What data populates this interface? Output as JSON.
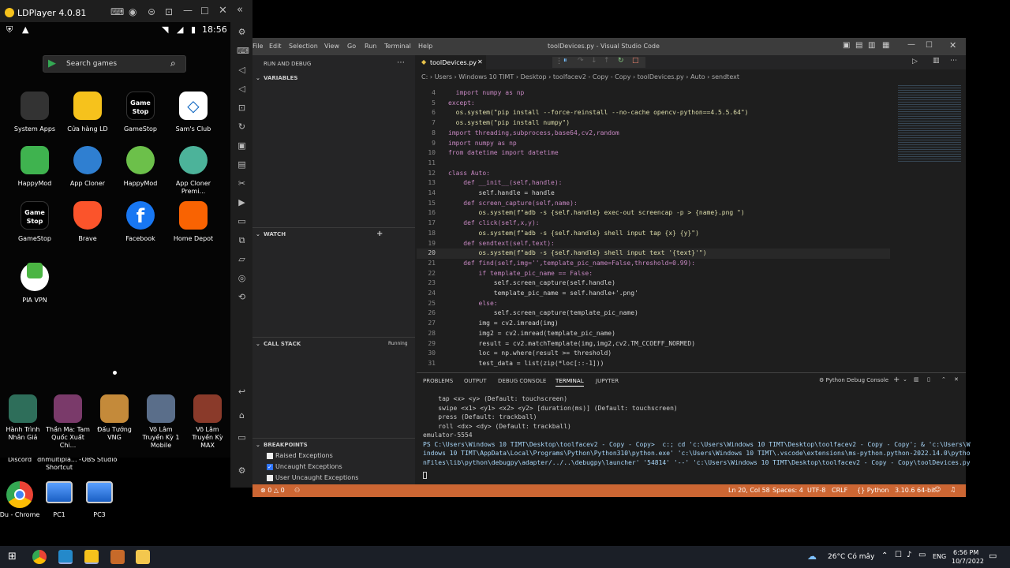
{
  "desktop": {
    "icons": [
      {
        "label": "Discord",
        "name": "discord"
      },
      {
        "label": "dnmultipla... - Shortcut",
        "name": "dnmultiplayer-shortcut"
      },
      {
        "label": "OBS Studio",
        "name": "obs-studio"
      },
      {
        "label": "Du - Chrome",
        "name": "chrome-shortcut"
      },
      {
        "label": "PC1",
        "name": "pc1"
      },
      {
        "label": "PC3",
        "name": "pc3"
      }
    ]
  },
  "ldplayer": {
    "title": "LDPlayer 4.0.81",
    "time": "18:56",
    "search_placeholder": "Search games",
    "apps": [
      {
        "label": "System Apps"
      },
      {
        "label": "Cửa hàng LD"
      },
      {
        "label": "GameStop"
      },
      {
        "label": "Sam's Club"
      },
      {
        "label": "HappyMod"
      },
      {
        "label": "App Cloner"
      },
      {
        "label": "HappyMod"
      },
      {
        "label": "App Cloner Premi..."
      },
      {
        "label": "GameStop"
      },
      {
        "label": "Brave"
      },
      {
        "label": "Facebook"
      },
      {
        "label": "Home Depot"
      },
      {
        "label": "PIA VPN"
      }
    ],
    "games": [
      {
        "label": "Hành Trình Nhân Giả"
      },
      {
        "label": "Thần Ma: Tam Quốc Xuất Chi..."
      },
      {
        "label": "Đấu Tướng VNG"
      },
      {
        "label": "Võ Lâm Truyền Kỳ 1 Mobile"
      },
      {
        "label": "Võ Lâm Truyền Kỳ MAX"
      }
    ]
  },
  "vscode": {
    "window_title": "toolDevices.py - Visual Studio Code",
    "menu": [
      "File",
      "Edit",
      "Selection",
      "View",
      "Go",
      "Run",
      "Terminal",
      "Help"
    ],
    "sidebar": {
      "header": "RUN AND DEBUG",
      "variables": "VARIABLES",
      "watch": "WATCH",
      "call_stack": "CALL STACK",
      "call_stack_status": "Running",
      "breakpoints": "BREAKPOINTS",
      "breakpoint_items": [
        {
          "label": "Raised Exceptions",
          "checked": false
        },
        {
          "label": "Uncaught Exceptions",
          "checked": true
        },
        {
          "label": "User Uncaught Exceptions",
          "checked": false
        }
      ]
    },
    "tab": "toolDevices.py",
    "breadcrumb": [
      "C:",
      "Users",
      "Windows 10 TIMT",
      "Desktop",
      "toolfacev2 - Copy - Copy",
      "toolDevices.py",
      "Auto",
      "sendtext"
    ],
    "code": [
      {
        "n": "4",
        "t": "  import numpy as np"
      },
      {
        "n": "5",
        "t": "except:"
      },
      {
        "n": "6",
        "t": "  os.system(\"pip install --force-reinstall --no-cache opencv-python==4.5.5.64\")"
      },
      {
        "n": "7",
        "t": "  os.system(\"pip install numpy\")"
      },
      {
        "n": "8",
        "t": "import threading,subprocess,base64,cv2,random"
      },
      {
        "n": "9",
        "t": "import numpy as np"
      },
      {
        "n": "10",
        "t": "from datetime import datetime"
      },
      {
        "n": "11",
        "t": ""
      },
      {
        "n": "12",
        "t": "class Auto:"
      },
      {
        "n": "13",
        "t": "    def __init__(self,handle):"
      },
      {
        "n": "14",
        "t": "        self.handle = handle"
      },
      {
        "n": "15",
        "t": "    def screen_capture(self,name):"
      },
      {
        "n": "16",
        "t": "        os.system(f\"adb -s {self.handle} exec-out screencap -p > {name}.png \")"
      },
      {
        "n": "17",
        "t": "    def click(self,x,y):"
      },
      {
        "n": "18",
        "t": "        os.system(f\"adb -s {self.handle} shell input tap {x} {y}\")"
      },
      {
        "n": "19",
        "t": "    def sendtext(self,text):"
      },
      {
        "n": "20",
        "t": "        os.system(f\"adb -s {self.handle} shell input text '{text}'\")"
      },
      {
        "n": "21",
        "t": "    def find(self,img='',template_pic_name=False,threshold=0.99):"
      },
      {
        "n": "22",
        "t": "        if template_pic_name == False:"
      },
      {
        "n": "23",
        "t": "            self.screen_capture(self.handle)"
      },
      {
        "n": "24",
        "t": "            template_pic_name = self.handle+'.png'"
      },
      {
        "n": "25",
        "t": "        else:"
      },
      {
        "n": "26",
        "t": "            self.screen_capture(template_pic_name)"
      },
      {
        "n": "27",
        "t": "        img = cv2.imread(img)"
      },
      {
        "n": "28",
        "t": "        img2 = cv2.imread(template_pic_name)"
      },
      {
        "n": "29",
        "t": "        result = cv2.matchTemplate(img,img2,cv2.TM_CCOEFF_NORMED)"
      },
      {
        "n": "30",
        "t": "        loc = np.where(result >= threshold)"
      },
      {
        "n": "31",
        "t": "        test_data = list(zip(*loc[::-1]))"
      }
    ],
    "panel_tabs": [
      "PROBLEMS",
      "OUTPUT",
      "DEBUG CONSOLE",
      "TERMINAL",
      "JUPYTER"
    ],
    "panel_active": "TERMINAL",
    "terminal_selector": "Python Debug Console",
    "terminal": [
      "    tap <x> <y> (Default: touchscreen)",
      "    swipe <x1> <y1> <x2> <y2> [duration(ms)] (Default: touchscreen)",
      "    press (Default: trackball)",
      "    roll <dx> <dy> (Default: trackball)",
      "emulator-5554",
      "PS C:\\Users\\Windows 10 TIMT\\Desktop\\toolfacev2 - Copy - Copy>  c:; cd 'c:\\Users\\Windows 10 TIMT\\Desktop\\toolfacev2 - Copy - Copy'; & 'c:\\Users\\W",
      "indows 10 TIMT\\AppData\\Local\\Programs\\Python\\Python310\\python.exe' 'c:\\Users\\Windows 10 TIMT\\.vscode\\extensions\\ms-python.python-2022.14.0\\pytho",
      "nFiles\\lib\\python\\debugpy\\adapter/../..\\debugpy\\launcher' '54814' '--' 'c:\\Users\\Windows 10 TIMT\\Desktop\\toolfacev2 - Copy - Copy\\toolDevices.py"
    ],
    "status": {
      "errors": "0",
      "warnings": "0",
      "position": "Ln 20, Col 58",
      "spaces": "Spaces: 4",
      "encoding": "UTF-8",
      "eol": "CRLF",
      "language": "Python",
      "interpreter": "3.10.6 64-bit"
    }
  },
  "taskbar": {
    "weather": "26°C Có mây",
    "lang": "ENG",
    "time": "6:56 PM",
    "date": "10/7/2022"
  },
  "colors": {
    "status_bar": "#cc6633",
    "editor_bg": "#1e1e1e",
    "sidebar_bg": "#252526"
  }
}
